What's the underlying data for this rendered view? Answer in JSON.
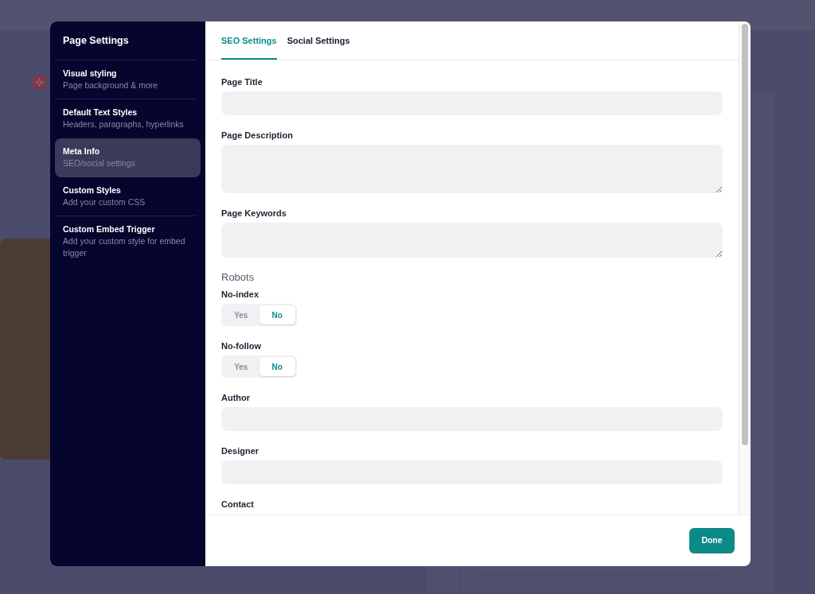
{
  "sidebar": {
    "title": "Page Settings",
    "items": [
      {
        "label": "Visual styling",
        "description": "Page background & more",
        "selected": false
      },
      {
        "label": "Default Text Styles",
        "description": "Headers, paragraphs, hyperlinks",
        "selected": false
      },
      {
        "label": "Meta Info",
        "description": "SEO/social settings",
        "selected": true
      },
      {
        "label": "Custom Styles",
        "description": "Add your custom CSS",
        "selected": false
      },
      {
        "label": "Custom Embed Trigger",
        "description": "Add your custom style for embed trigger",
        "selected": false
      }
    ]
  },
  "tabs": [
    {
      "label": "SEO Settings",
      "selected": true
    },
    {
      "label": "Social Settings",
      "selected": false
    }
  ],
  "fields": [
    {
      "kind": "input",
      "label": "Page Title"
    },
    {
      "kind": "textarea",
      "label": "Page Description"
    },
    {
      "kind": "textbox",
      "label": "Page Keywords"
    },
    {
      "kind": "heading",
      "label": "Robots"
    },
    {
      "kind": "toggle",
      "label": "No-index",
      "options": [
        {
          "label": "Yes",
          "selected": false
        },
        {
          "label": "No",
          "selected": true
        }
      ]
    },
    {
      "kind": "toggle",
      "label": "No-follow",
      "options": [
        {
          "label": "Yes",
          "selected": false
        },
        {
          "label": "No",
          "selected": true
        }
      ]
    },
    {
      "kind": "input",
      "label": "Author"
    },
    {
      "kind": "input",
      "label": "Designer"
    },
    {
      "kind": "label",
      "label": "Contact"
    }
  ],
  "done_button": "Done"
}
